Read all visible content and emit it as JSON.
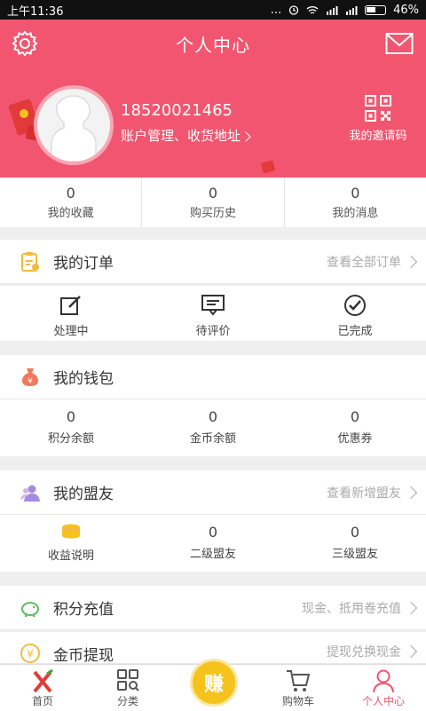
{
  "status": {
    "time": "上午11:36",
    "dots": "...",
    "battery": "46%"
  },
  "header": {
    "title": "个人中心"
  },
  "profile": {
    "phone": "18520021465",
    "account_link": "账户管理、收货地址",
    "invite_label": "我的邀请码"
  },
  "stats": [
    {
      "value": "0",
      "label": "我的收藏"
    },
    {
      "value": "0",
      "label": "购买历史"
    },
    {
      "value": "0",
      "label": "我的消息"
    }
  ],
  "orders": {
    "title": "我的订单",
    "link": "查看全部订单",
    "items": [
      {
        "label": "处理中"
      },
      {
        "label": "待评价"
      },
      {
        "label": "已完成"
      }
    ]
  },
  "wallet": {
    "title": "我的钱包",
    "items": [
      {
        "value": "0",
        "label": "积分余额"
      },
      {
        "value": "0",
        "label": "金币余额"
      },
      {
        "value": "0",
        "label": "优惠券"
      }
    ]
  },
  "allies": {
    "title": "我的盟友",
    "link": "查看新增盟友",
    "items": [
      {
        "label": "收益说明"
      },
      {
        "value": "0",
        "label": "二级盟友"
      },
      {
        "value": "0",
        "label": "三级盟友"
      }
    ]
  },
  "recharge": {
    "title": "积分充值",
    "link": "现金、抵用卷充值"
  },
  "withdraw": {
    "title": "金币提现",
    "link": "提现兑换现金"
  },
  "tabbar": {
    "items": [
      {
        "label": "首页"
      },
      {
        "label": "分类"
      },
      {
        "label": "赚"
      },
      {
        "label": "购物车"
      },
      {
        "label": "个人中心"
      }
    ]
  },
  "colors": {
    "brand": "#f2556f",
    "accent": "#f6c21c"
  }
}
